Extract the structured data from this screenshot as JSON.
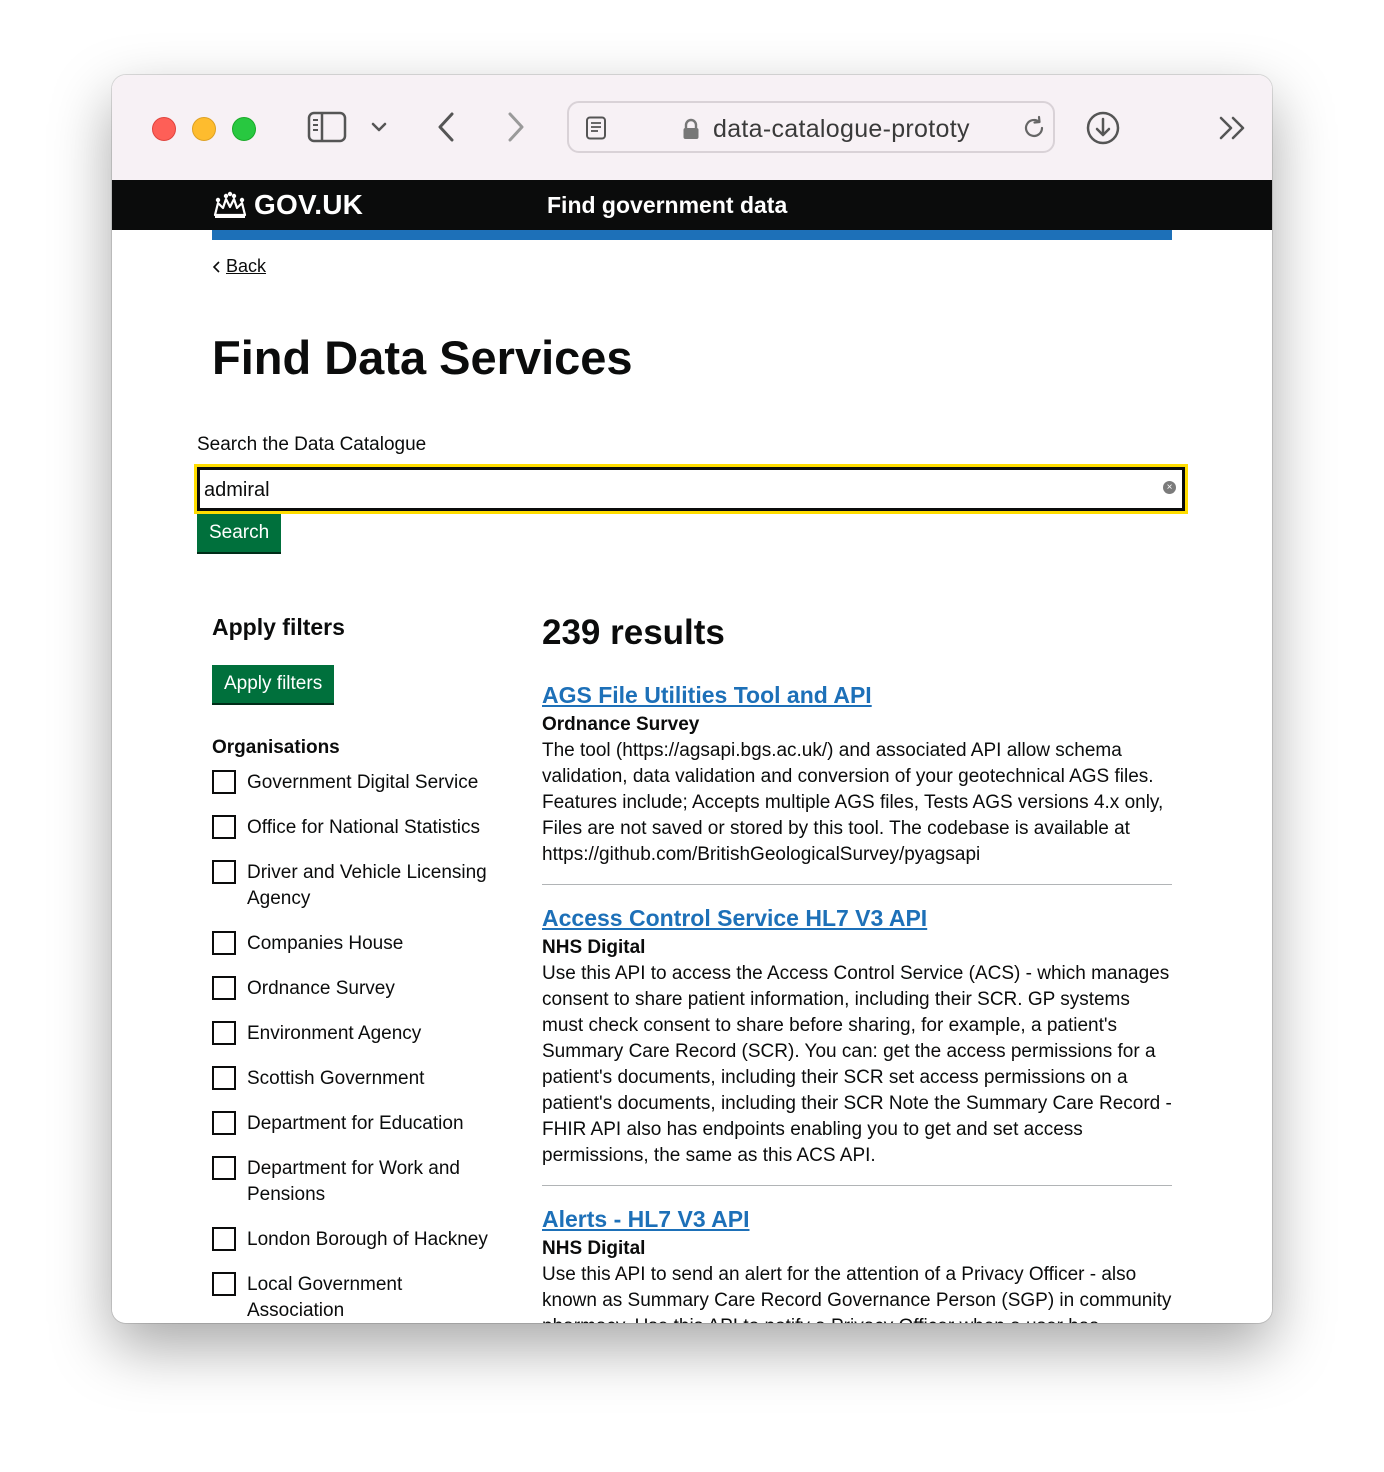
{
  "browser": {
    "url": "data-catalogue-prototy"
  },
  "header": {
    "logo_text": "GOV.UK",
    "service_name": "Find government data"
  },
  "nav": {
    "back_label": "Back"
  },
  "page": {
    "title": "Find Data Services"
  },
  "search": {
    "label": "Search the Data Catalogue",
    "value": "admiral",
    "button_label": "Search"
  },
  "filters": {
    "title": "Apply filters",
    "button_label": "Apply filters",
    "organisations_heading": "Organisations",
    "organisations": [
      "Government Digital Service",
      "Office for National Statistics",
      "Driver and Vehicle Licensing Agency",
      "Companies House",
      "Ordnance Survey",
      "Environment Agency",
      "Scottish Government",
      "Department for Education",
      "Department for Work and Pensions",
      "London Borough of Hackney",
      "Local Government Association"
    ]
  },
  "results": {
    "count_text": "239 results",
    "items": [
      {
        "title": "AGS File Utilities Tool and API",
        "organisation": "Ordnance Survey",
        "description": "The tool (https://agsapi.bgs.ac.uk/) and associated API allow schema validation, data validation and conversion of your geotechnical AGS files. Features include; Accepts multiple AGS files, Tests AGS versions 4.x only, Files are not saved or stored by this tool. The codebase is available at https://github.com/BritishGeologicalSurvey/pyagsapi"
      },
      {
        "title": "Access Control Service HL7 V3 API",
        "organisation": "NHS Digital",
        "description": "Use this API to access the Access Control Service (ACS) - which manages consent to share patient information, including their SCR. GP systems must check consent to share before sharing, for example, a patient's Summary Care Record (SCR). You can: get the access permissions for a patient's documents, including their SCR set access permissions on a patient's documents, including their SCR Note the Summary Care Record - FHIR API also has endpoints enabling you to get and set access permissions, the same as this ACS API."
      },
      {
        "title": "Alerts - HL7 V3 API",
        "organisation": "NHS Digital",
        "description": "Use this API to send an alert for the attention of a Privacy Officer - also known as Summary Care Record Governance Person (SGP) in community pharmacy. Use this API to notify a Privacy Officer when a user has accessed a patient's record..."
      }
    ]
  },
  "colors": {
    "gov_black": "#0b0c0c",
    "gov_blue": "#1d70b8",
    "gov_green": "#00703c",
    "focus_yellow": "#ffdd00"
  }
}
